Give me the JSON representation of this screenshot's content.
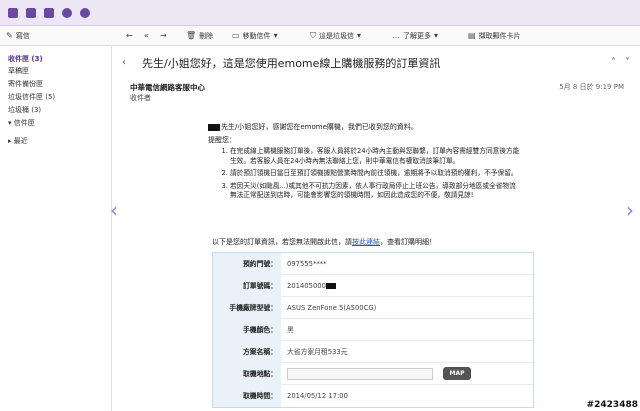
{
  "top_icons": [
    "mail-icon",
    "contacts-icon",
    "calendar-icon",
    "notepad-icon",
    "messenger-icon"
  ],
  "toolbar": {
    "compose": "寫信",
    "delete": "刪除",
    "move": "移動信件",
    "spam": "這是垃圾信",
    "more": "了解更多",
    "add_contact": "擷取郵件卡片"
  },
  "sidebar": {
    "items": [
      {
        "label": "收件匣 (3)",
        "active": true
      },
      {
        "label": "草稿匣",
        "active": false
      },
      {
        "label": "寄件備份匣",
        "active": false
      },
      {
        "label": "垃圾信件匣 (5)",
        "active": false
      },
      {
        "label": "垃圾桶 (3)",
        "active": false
      },
      {
        "label": "信件匣",
        "active": false
      },
      {
        "label": "最近",
        "active": false
      }
    ]
  },
  "email": {
    "subject": "先生/小姐您好，這是您使用emome線上購機服務的訂單資訊",
    "sender": "中華電信網路客服中心",
    "recipient": "收件者",
    "date": "5月 8 日於 9:19 PM",
    "greeting": "先生/小姐您好，感謝您在emome購機，我們已收到您的資料。",
    "reminder_title": "提醒您：",
    "terms": [
      "在完成線上購機服務訂單後，客服人員將於24小時內主動與您聯繫，訂單內容需經雙方同意後方能生效。若客服人員在24小時內無法聯絡上您，則中華電信有權取消該筆訂單。",
      "請於預訂領機日當日至預訂領機據點營業時間內前往領機，逾期將予以取消預約權利，不予保留。",
      "若因天災(如颱風...)或其他不可抗力因素，依人事行政局停止上班公告，導致部分地區或全省物流無法正常配送到店時，可能會影響您的領機時間，如因此造成您的不便，敬請見諒!"
    ],
    "order_intro_prefix": "以下是您的訂單資訊，若您無法開啟此信，請",
    "order_intro_link": "按此連結",
    "order_intro_suffix": "，查看訂購明細！",
    "order": [
      {
        "label": "預約門號：",
        "value": "097555****"
      },
      {
        "label": "訂單號碼：",
        "value": "201405000"
      },
      {
        "label": "手機廠牌型號：",
        "value": "ASUS ZenFone 5(A500CG)"
      },
      {
        "label": "手機顏色：",
        "value": "黑"
      },
      {
        "label": "方案名稱：",
        "value": "大省方案月租533元"
      },
      {
        "label": "取機地點：",
        "value": ""
      },
      {
        "label": "取機時間：",
        "value": "2014/05/12 17:00"
      }
    ],
    "map_button": "MAP"
  },
  "watermark": "#2423488",
  "colors": {
    "accent": "#5a2d91",
    "topbar": "#ede7f5",
    "table_label_bg": "#e9f2f8"
  }
}
